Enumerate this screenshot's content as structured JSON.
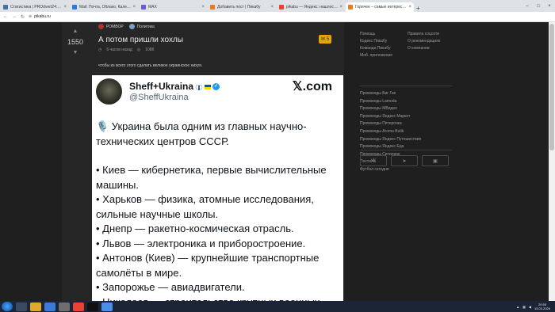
{
  "browser": {
    "tabs": [
      {
        "title": "Статистика | PROdvert24: Програ",
        "color": "#4a6fa5",
        "active": false
      },
      {
        "title": "Mail: Почта, Облако, Календари",
        "color": "#2a7ae4",
        "active": false
      },
      {
        "title": "MAX",
        "color": "#6a5cd6",
        "active": false
      },
      {
        "title": "Добавить пост | Пикабу",
        "color": "#f07a1a",
        "active": false
      },
      {
        "title": "pikabu — Яндекс: нашлось 4 тыс",
        "color": "#e8442f",
        "active": false
      },
      {
        "title": "Горячее – самые интересные и обс",
        "color": "#f07a1a",
        "active": true
      }
    ],
    "url": "pikabu.ru"
  },
  "post": {
    "author": "РОМВОР",
    "community": "Политика",
    "score": "1550",
    "title": "А потом пришли хохлы",
    "time": "6 часов назад",
    "team": "108К",
    "comments": "5",
    "caption": "чтобы из всего этого сделать великое украинское нихуя."
  },
  "tweet": {
    "name": "Sheff+Ukraina",
    "handle": "@SheffUkraina",
    "brand": "𝕏.com",
    "lines": [
      "🎙️ Украина была одним из главных научно-технических центров СССР.",
      "",
      "• Киев — кибернетика, первые вычислительные машины.",
      "• Харьков — физика, атомные исследования, сильные научные школы.",
      "• Днепр — ракетно-космическая отрасль.",
      "• Львов — электроника и приборостроение.",
      "• Антонов (Киев) — крупнейшие транспортные самолёты в мире.",
      "• Запорожье — авиадвигатели.",
      "• Николаев — строительство крупных военных"
    ]
  },
  "sidebar": {
    "links": [
      "Помощь",
      "Правила соцсети",
      "Кодекс Пикабу",
      "О рекомендациях",
      "Команда Пикабу",
      "О компании",
      "Моб. приложение",
      ""
    ],
    "promo": [
      "Промокоды Биг Гик",
      "Промокоды Lamoda",
      "Промокоды МВидео",
      "Промокоды Яндекс Маркет",
      "Промокоды Пятерочка",
      "Промокоды Aroma Butik",
      "Промокоды Яндекс Путешествия",
      "Промокоды Яндекс Еда",
      "Промокоды Ситилинк",
      "Постила",
      "Футбол сегодня"
    ],
    "socials": [
      "vk-icon",
      "telegram-icon",
      "ok-icon"
    ]
  },
  "taskbar": {
    "time": "20:55",
    "date": "15.03.2026"
  }
}
